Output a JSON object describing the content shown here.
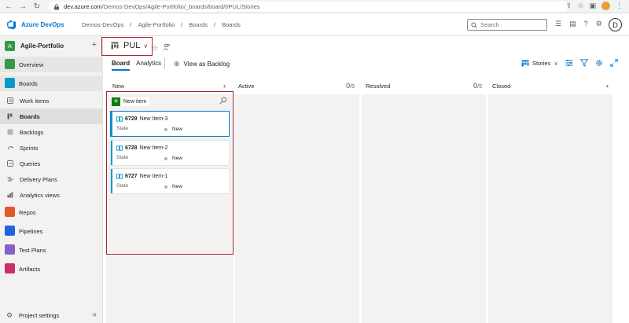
{
  "browser": {
    "url_host": "dev.azure.com",
    "url_path": "/Demos-DevOps/Agile-Portfolio/_boards/board/t/PUL/Stories"
  },
  "topbar": {
    "brand": "Azure DevOps",
    "breadcrumbs": [
      "Demos-DevOps",
      "Agile-Portfolio",
      "Boards",
      "Boards"
    ],
    "search_placeholder": "Search",
    "user_initial": "D"
  },
  "sidebar": {
    "project_badge": "A",
    "project_name": "Agile-Portfolio",
    "items": [
      {
        "label": "Overview",
        "icon": "overview-icon"
      },
      {
        "label": "Boards",
        "icon": "boards-icon"
      },
      {
        "label": "Work items",
        "icon": "work-items-icon"
      },
      {
        "label": "Boards",
        "icon": "board-icon"
      },
      {
        "label": "Backlogs",
        "icon": "backlogs-icon"
      },
      {
        "label": "Sprints",
        "icon": "sprints-icon"
      },
      {
        "label": "Queries",
        "icon": "queries-icon"
      },
      {
        "label": "Delivery Plans",
        "icon": "delivery-plans-icon"
      },
      {
        "label": "Analytics views",
        "icon": "analytics-views-icon"
      },
      {
        "label": "Repos",
        "icon": "repos-icon"
      },
      {
        "label": "Pipelines",
        "icon": "pipelines-icon"
      },
      {
        "label": "Test Plans",
        "icon": "test-plans-icon"
      },
      {
        "label": "Artifacts",
        "icon": "artifacts-icon"
      }
    ],
    "project_settings": "Project settings",
    "colors": {
      "overview": "#339947",
      "boards": "#009ccc",
      "repos": "#e05b2b",
      "pipelines": "#2560e0",
      "test_plans": "#8661c5",
      "artifacts": "#cb2e6d"
    }
  },
  "main": {
    "board_name": "PUL",
    "tabs": {
      "board": "Board",
      "analytics": "Analytics"
    },
    "view_as_backlog": "View as Backlog",
    "backlog_level": "Stories",
    "columns": {
      "new": {
        "title": "New"
      },
      "active": {
        "title": "Active",
        "count": "0",
        "limit": "/5"
      },
      "resolved": {
        "title": "Resolved",
        "count": "0",
        "limit": "/5"
      },
      "closed": {
        "title": "Closed"
      }
    },
    "new_item_label": "New item",
    "state_label": "State",
    "cards": [
      {
        "id": "6729",
        "title": "New Item-3",
        "state": "New"
      },
      {
        "id": "6728",
        "title": "New Item-2",
        "state": "New"
      },
      {
        "id": "6727",
        "title": "New Item-1",
        "state": "New"
      }
    ]
  }
}
